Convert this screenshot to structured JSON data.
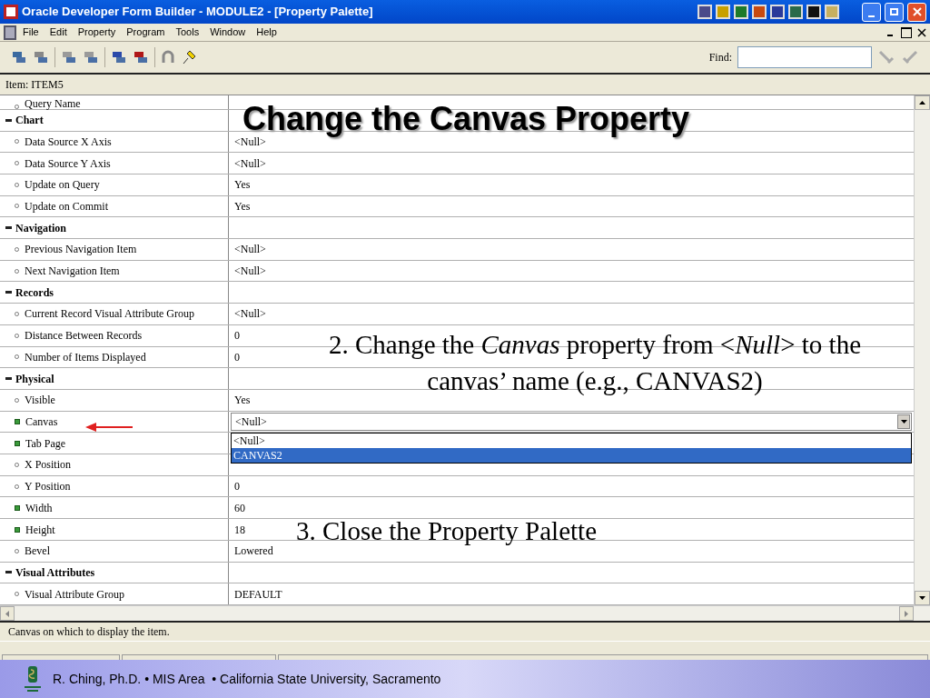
{
  "window": {
    "title": "Oracle Developer Form Builder - MODULE2 - [Property Palette]"
  },
  "menu": [
    "File",
    "Edit",
    "Property",
    "Program",
    "Tools",
    "Window",
    "Help"
  ],
  "find": {
    "label": "Find:"
  },
  "item_label": "Item: ITEM5",
  "properties": [
    {
      "kind": "property",
      "name": "Query Name",
      "modified": false
    },
    {
      "kind": "group",
      "name": "Chart"
    },
    {
      "kind": "property",
      "name": "Data Source X Axis",
      "value": "<Null>",
      "modified": false
    },
    {
      "kind": "property",
      "name": "Data Source Y Axis",
      "value": "<Null>",
      "modified": false
    },
    {
      "kind": "property",
      "name": "Update on Query",
      "value": "Yes",
      "modified": false
    },
    {
      "kind": "property",
      "name": "Update on Commit",
      "value": "Yes",
      "modified": false
    },
    {
      "kind": "group",
      "name": "Navigation"
    },
    {
      "kind": "property",
      "name": "Previous Navigation Item",
      "value": "<Null>",
      "modified": false
    },
    {
      "kind": "property",
      "name": "Next Navigation Item",
      "value": "<Null>",
      "modified": false
    },
    {
      "kind": "group",
      "name": "Records"
    },
    {
      "kind": "property",
      "name": "Current Record Visual Attribute Group",
      "value": "<Null>",
      "modified": false
    },
    {
      "kind": "property",
      "name": "Distance Between Records",
      "value": "0",
      "modified": false
    },
    {
      "kind": "property",
      "name": "Number of Items Displayed",
      "value": "0",
      "modified": false
    },
    {
      "kind": "group",
      "name": "Physical"
    },
    {
      "kind": "property",
      "name": "Visible",
      "value": "Yes",
      "modified": false
    },
    {
      "kind": "dropdown",
      "name": "Canvas",
      "value": "<Null>",
      "modified": true,
      "options": [
        {
          "label": "<Null>",
          "highlighted": false
        },
        {
          "label": "CANVAS2",
          "highlighted": true
        }
      ]
    },
    {
      "kind": "property",
      "name": "Tab Page",
      "modified": true
    },
    {
      "kind": "property",
      "name": "X Position",
      "modified": false
    },
    {
      "kind": "property",
      "name": "Y Position",
      "value": "0",
      "modified": false
    },
    {
      "kind": "property",
      "name": "Width",
      "value": "60",
      "modified": true
    },
    {
      "kind": "property",
      "name": "Height",
      "value": "18",
      "modified": true
    },
    {
      "kind": "property",
      "name": "Bevel",
      "value": "Lowered",
      "modified": false
    },
    {
      "kind": "group",
      "name": "Visual Attributes"
    },
    {
      "kind": "property",
      "name": "Visual Attribute Group",
      "value": "DEFAULT",
      "modified": false
    }
  ],
  "hint": "Canvas on which to display the item.",
  "slide": {
    "title": "Change the Canvas Property",
    "step_2": "2. Change the *Canvas* property from <*Null*> to the canvas’ name (e.g., CANVAS2)",
    "step_3": "3. Close the Property Palette",
    "footer": "R. Ching, Ph.D. • MIS Area  • California State University, Sacramento"
  }
}
